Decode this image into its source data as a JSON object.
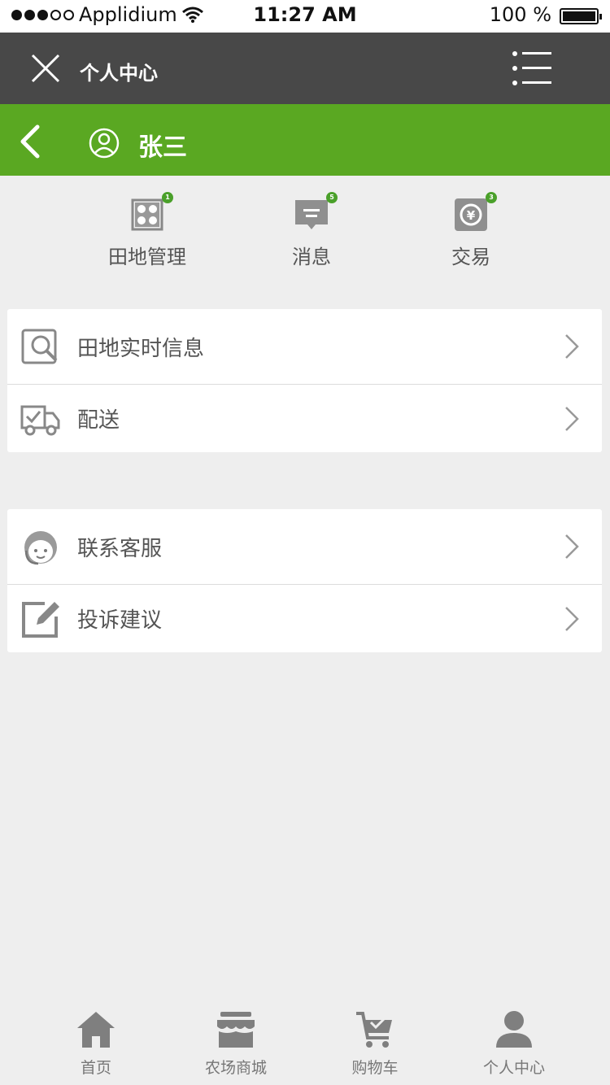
{
  "status_bar": {
    "carrier": "Applidium",
    "time": "11:27 AM",
    "battery": "100 %"
  },
  "topbar": {
    "title": "个人中心"
  },
  "profile": {
    "username": "张三"
  },
  "quick_actions": [
    {
      "label": "田地管理",
      "badge": "1",
      "icon": "field-grid-icon"
    },
    {
      "label": "消息",
      "badge": "5",
      "icon": "message-icon"
    },
    {
      "label": "交易",
      "badge": "3",
      "icon": "yuan-exchange-icon"
    }
  ],
  "menu_group_1": [
    {
      "label": "田地实时信息",
      "icon": "search-field-icon"
    },
    {
      "label": "配送",
      "icon": "delivery-truck-icon"
    }
  ],
  "menu_group_2": [
    {
      "label": "联系客服",
      "icon": "customer-service-icon"
    },
    {
      "label": "投诉建议",
      "icon": "edit-feedback-icon"
    }
  ],
  "tabbar": [
    {
      "label": "首页",
      "icon": "home-icon"
    },
    {
      "label": "农场商城",
      "icon": "store-icon"
    },
    {
      "label": "购物车",
      "icon": "cart-icon"
    },
    {
      "label": "个人中心",
      "icon": "person-icon"
    }
  ],
  "colors": {
    "green": "#5aa822",
    "topbar": "#484848",
    "background": "#eeeeee",
    "icon_gray": "#888888"
  }
}
